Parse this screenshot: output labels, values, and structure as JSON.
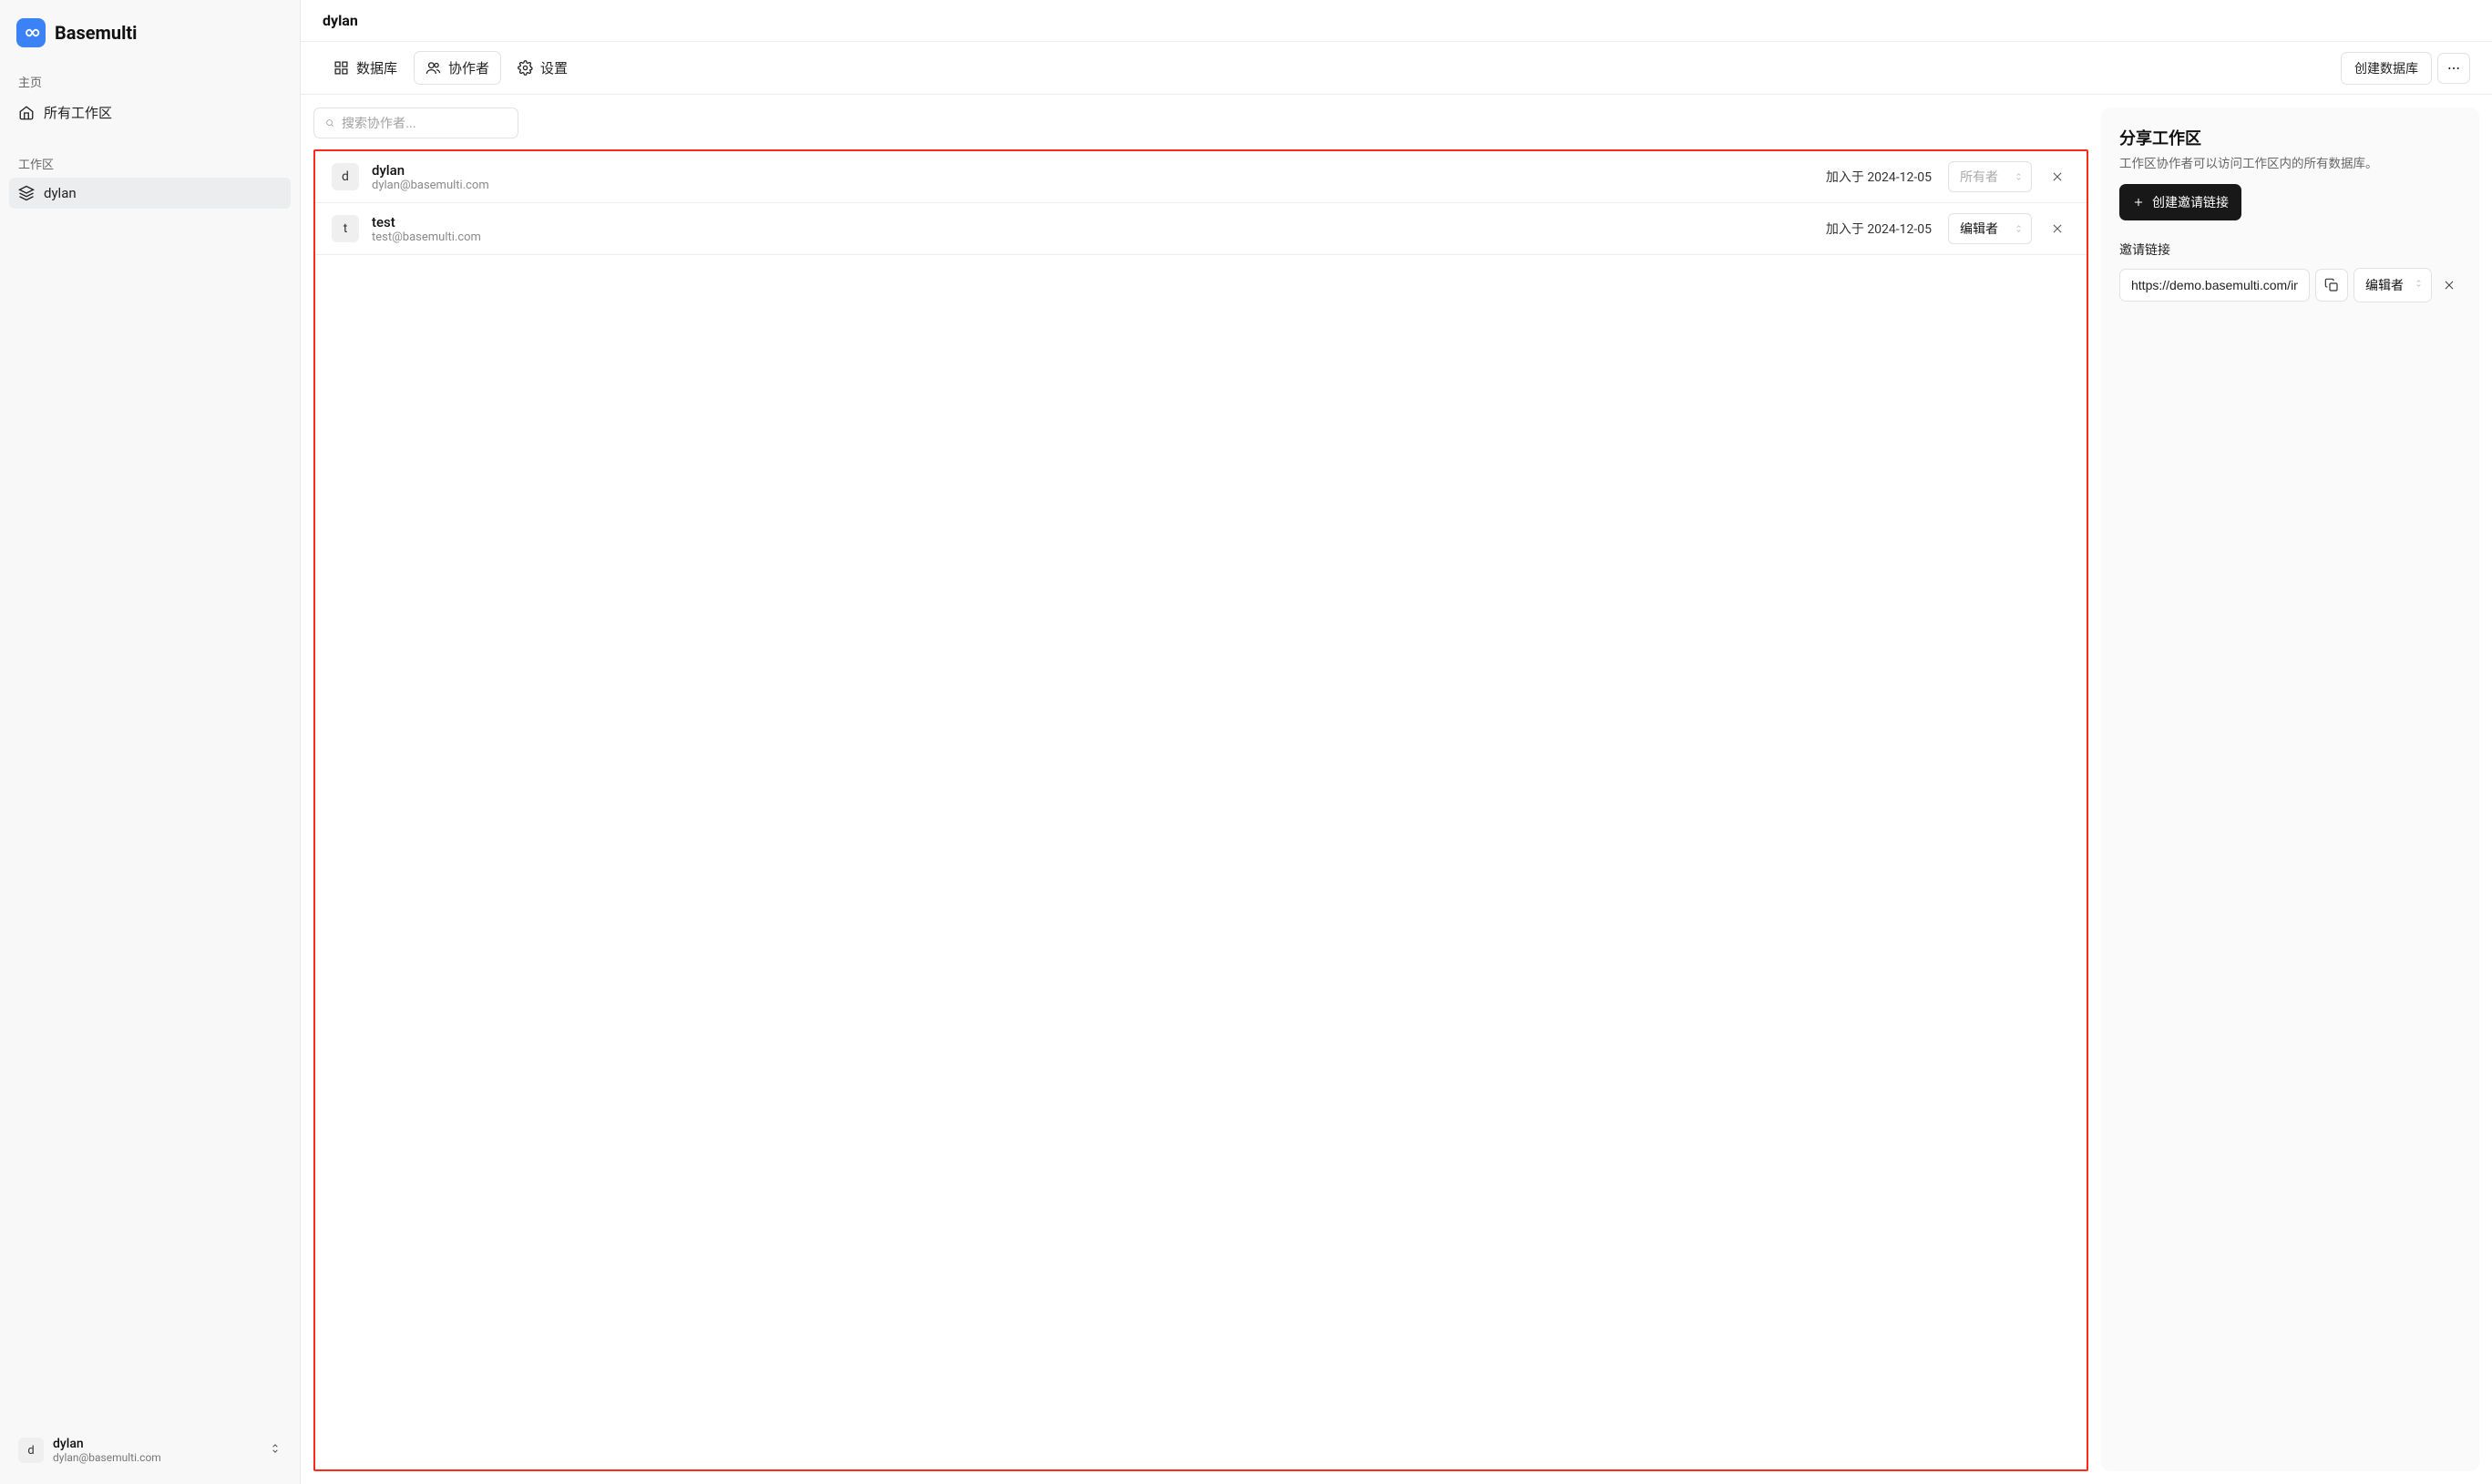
{
  "brand": "Basemulti",
  "sidebar": {
    "home_label": "主页",
    "all_workspaces": "所有工作区",
    "workspace_label": "工作区",
    "workspace_items": [
      "dylan"
    ]
  },
  "current_user": {
    "name": "dylan",
    "email": "dylan@basemulti.com",
    "initial": "d"
  },
  "header": {
    "title": "dylan"
  },
  "tabs": {
    "database": "数据库",
    "collaborators": "协作者",
    "settings": "设置",
    "create_db": "创建数据库"
  },
  "search": {
    "placeholder": "搜索协作者..."
  },
  "collaborators": [
    {
      "initial": "d",
      "name": "dylan",
      "email": "dylan@basemulti.com",
      "joined": "加入于 2024-12-05",
      "role": "所有者",
      "role_disabled": true
    },
    {
      "initial": "t",
      "name": "test",
      "email": "test@basemulti.com",
      "joined": "加入于 2024-12-05",
      "role": "编辑者",
      "role_disabled": false
    }
  ],
  "share": {
    "title": "分享工作区",
    "desc": "工作区协作者可以访问工作区内的所有数据库。",
    "create_link": "创建邀请链接",
    "links_label": "邀请链接",
    "link_url": "https://demo.basemulti.com/invite",
    "link_role": "编辑者"
  }
}
